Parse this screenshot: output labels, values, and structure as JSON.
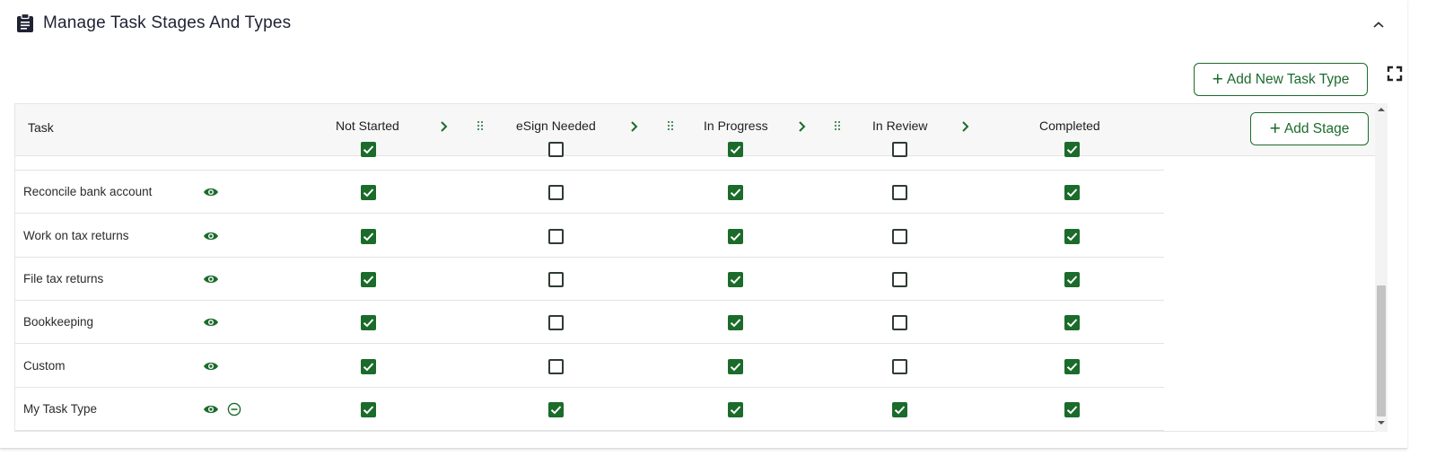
{
  "header": {
    "title": "Manage Task Stages And Types",
    "icon": "clipboard-icon"
  },
  "toolbar": {
    "add_task_type_label": "Add New Task Type",
    "add_stage_label": "Add Stage"
  },
  "table": {
    "task_header": "Task",
    "stages": [
      "Not Started",
      "eSign Needed",
      "In Progress",
      "In Review",
      "Completed"
    ],
    "rows": [
      {
        "task": "",
        "checks": [
          true,
          false,
          true,
          false,
          true
        ],
        "removable": false
      },
      {
        "task": "Reconcile bank account",
        "checks": [
          true,
          false,
          true,
          false,
          true
        ],
        "removable": false
      },
      {
        "task": "Work on tax returns",
        "checks": [
          true,
          false,
          true,
          false,
          true
        ],
        "removable": false
      },
      {
        "task": "File tax returns",
        "checks": [
          true,
          false,
          true,
          false,
          true
        ],
        "removable": false
      },
      {
        "task": "Bookkeeping",
        "checks": [
          true,
          false,
          true,
          false,
          true
        ],
        "removable": false
      },
      {
        "task": "Custom",
        "checks": [
          true,
          false,
          true,
          false,
          true
        ],
        "removable": false
      },
      {
        "task": "My Task Type",
        "checks": [
          true,
          true,
          true,
          true,
          true
        ],
        "removable": true
      }
    ]
  },
  "colors": {
    "accent": "#1b6b2b",
    "header_bg": "#f7f7f7",
    "border": "#e3e3e3"
  }
}
